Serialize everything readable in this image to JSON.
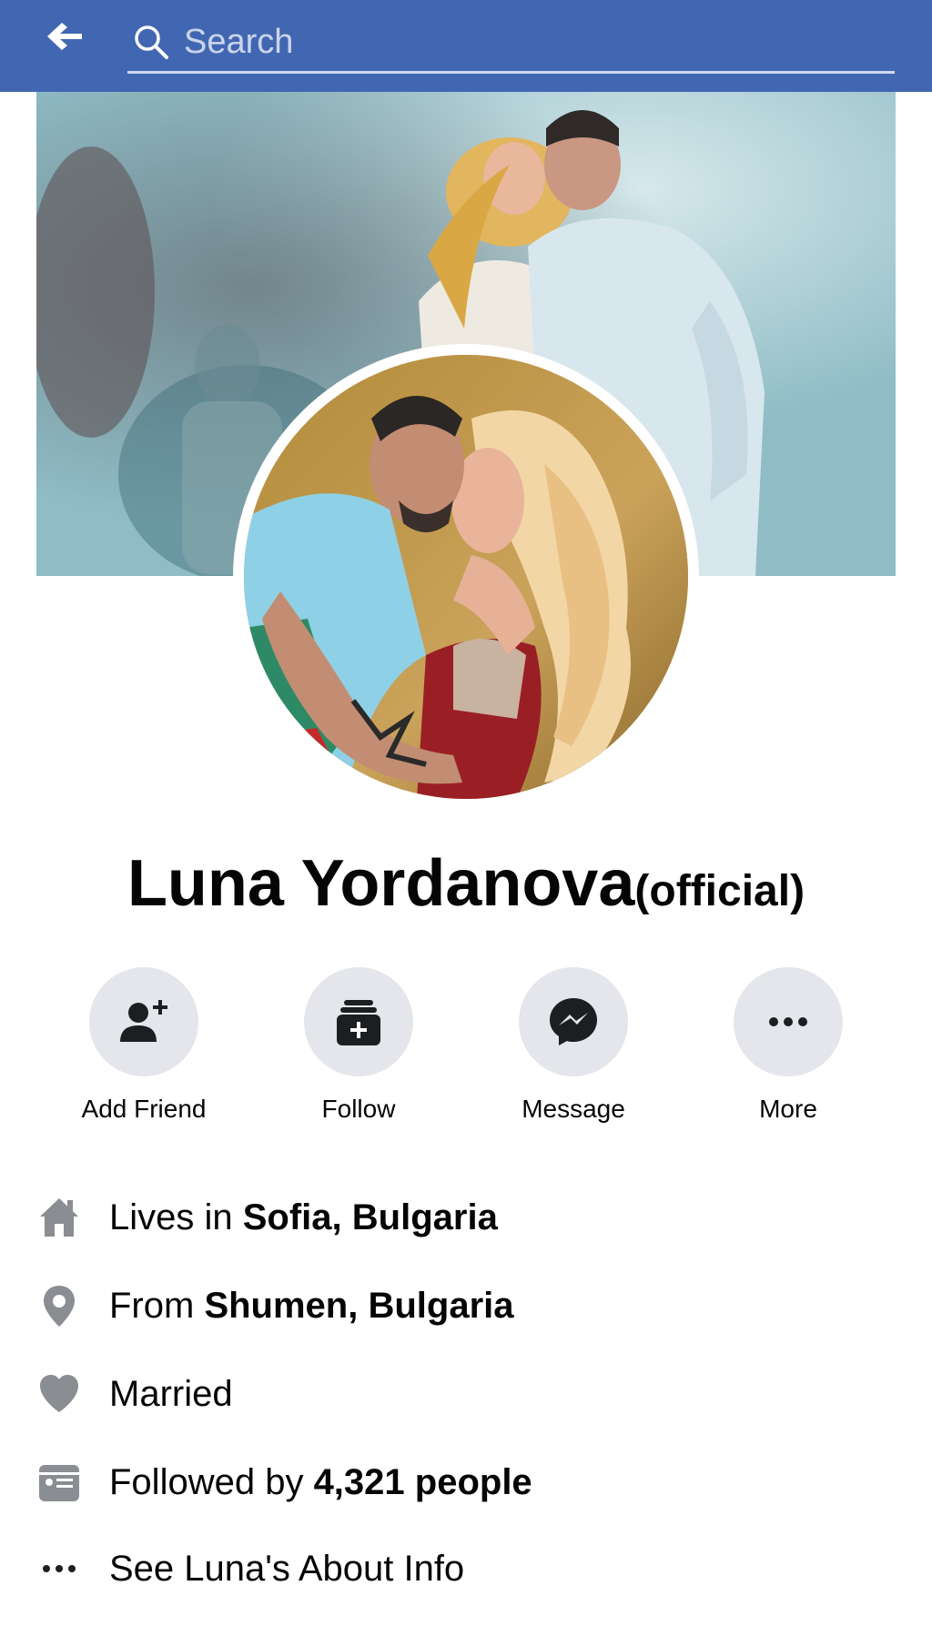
{
  "header": {
    "search_placeholder": "Search",
    "back_icon": "back-arrow-icon",
    "search_icon": "search-icon",
    "bar_color": "#4267b2"
  },
  "profile": {
    "name": "Luna Yordanova",
    "name_suffix": "(official)"
  },
  "actions": [
    {
      "label": "Add Friend",
      "icon": "add-friend-icon"
    },
    {
      "label": "Follow",
      "icon": "follow-icon"
    },
    {
      "label": "Message",
      "icon": "messenger-icon"
    },
    {
      "label": "More",
      "icon": "more-icon"
    }
  ],
  "info": {
    "lives_in": {
      "prefix": "Lives in ",
      "value": "Sofia, Bulgaria",
      "icon": "home-icon"
    },
    "from": {
      "prefix": "From ",
      "value": "Shumen, Bulgaria",
      "icon": "location-pin-icon"
    },
    "relationship": {
      "text": "Married",
      "icon": "heart-icon"
    },
    "followers": {
      "prefix": "Followed by ",
      "value": "4,321 people",
      "icon": "followers-card-icon"
    },
    "about": {
      "text": "See Luna's About Info",
      "icon": "more-dots-icon"
    }
  },
  "colors": {
    "icon_gray": "#8a8d91",
    "button_bg": "#e4e6eb",
    "text": "#050505"
  }
}
